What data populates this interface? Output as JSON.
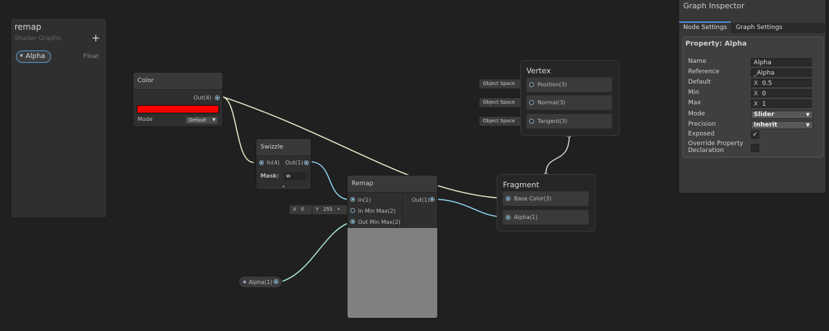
{
  "blackboard": {
    "title": "remap",
    "subtitle": "Shader Graphs",
    "add_label": "+",
    "property_name": "Alpha",
    "property_type": "Float"
  },
  "color_node": {
    "title": "Color",
    "output": "Out(4)",
    "swatch_color": "#ff0000",
    "mode_label": "Mode",
    "mode_value": "Default"
  },
  "swizzle_node": {
    "title": "Swizzle",
    "input": "In(4)",
    "output": "Out(1)",
    "mask_label": "Mask:",
    "mask_value": "w"
  },
  "remap_node": {
    "title": "Remap",
    "in": "In(1)",
    "in_min_max": "In Min Max(2)",
    "out_min_max": "Out Min Max(2)",
    "out": "Out(1)",
    "x_label": "X",
    "x_value": "0",
    "y_label": "Y",
    "y_value": "255"
  },
  "alpha_node": {
    "label": "Alpha(1)"
  },
  "vertex_context": {
    "title": "Vertex",
    "slots": [
      "Position(3)",
      "Normal(3)",
      "Tangent(3)"
    ],
    "space_label": "Object Space"
  },
  "fragment_context": {
    "title": "Fragment",
    "slots": [
      "Base Color(3)",
      "Alpha(1)"
    ]
  },
  "inspector": {
    "title": "Graph Inspector",
    "tabs": [
      "Node Settings",
      "Graph Settings"
    ],
    "property_title": "Property: Alpha",
    "labels": [
      "Name",
      "Reference",
      "Default",
      "Min",
      "Max",
      "Mode",
      "Precision",
      "Exposed",
      "Override Property Declaration"
    ],
    "name": "Alpha",
    "reference": "_Alpha",
    "default": "0.5",
    "min": "0",
    "max": "1",
    "mode": "Slider",
    "precision": "Inherit",
    "exposed_check": "✓",
    "x_label": "X"
  },
  "colors": {
    "wire_vec4": "#e8e8c8",
    "wire_float": "#8ad0e8",
    "accent": "#4a90d8",
    "background": "#202020"
  }
}
